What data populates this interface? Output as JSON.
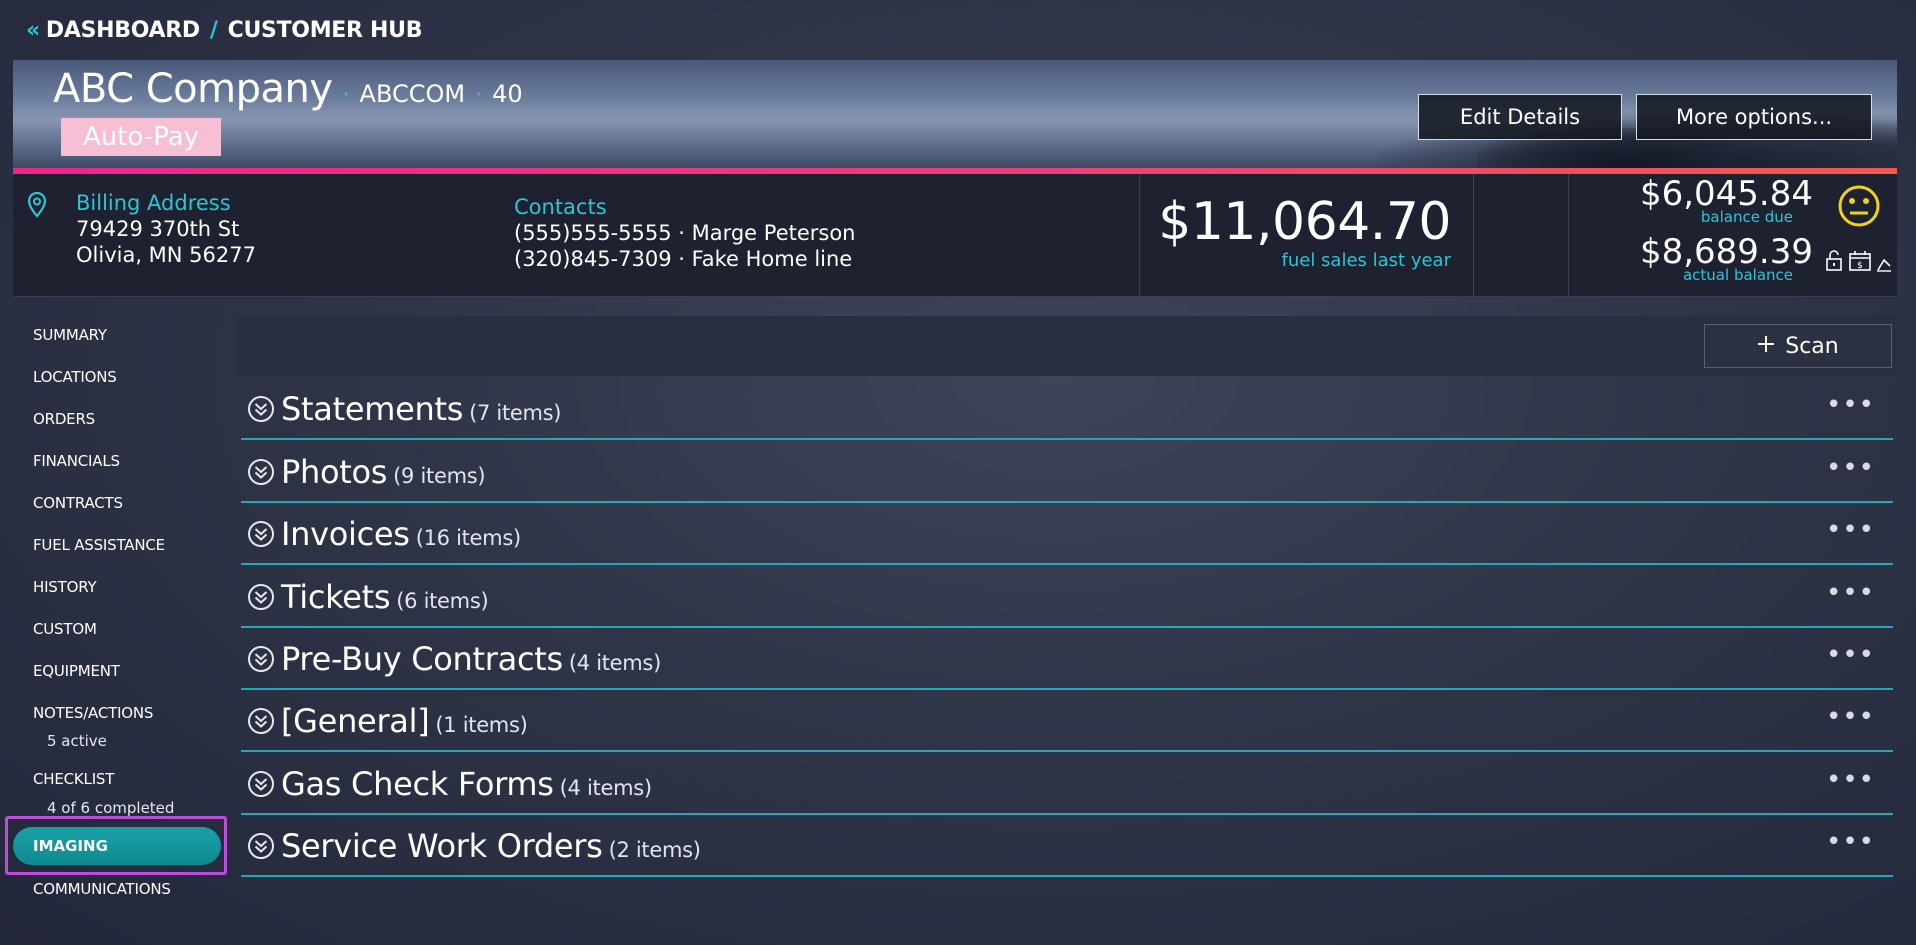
{
  "breadcrumb": {
    "items": [
      "DASHBOARD",
      "CUSTOMER HUB"
    ]
  },
  "customer": {
    "name": "ABC Company",
    "code": "ABCCOM",
    "number": "40",
    "badge": "Auto-Pay"
  },
  "header_actions": {
    "edit_label": "Edit Details",
    "more_label": "More options..."
  },
  "billing": {
    "title": "Billing Address",
    "line1": "79429 370th St",
    "line2": "Olivia, MN 56277"
  },
  "contacts": {
    "title": "Contacts",
    "items": [
      "(555)555-5555 · Marge Peterson",
      "(320)845-7309 · Fake Home line"
    ]
  },
  "fuel_sales": {
    "amount": "$11,064.70",
    "label": "fuel sales last year"
  },
  "balance": {
    "due_amount": "$6,045.84",
    "due_label": "balance due",
    "actual_amount": "$8,689.39",
    "actual_label": "actual balance",
    "status_icon": "neutral-face-icon"
  },
  "sidebar": {
    "items": [
      {
        "label": "SUMMARY"
      },
      {
        "label": "LOCATIONS"
      },
      {
        "label": "ORDERS"
      },
      {
        "label": "FINANCIALS"
      },
      {
        "label": "CONTRACTS"
      },
      {
        "label": "FUEL ASSISTANCE"
      },
      {
        "label": "HISTORY"
      },
      {
        "label": "CUSTOM"
      },
      {
        "label": "EQUIPMENT"
      },
      {
        "label": "NOTES/ACTIONS",
        "sub": "5 active"
      },
      {
        "label": "CHECKLIST",
        "sub": "4 of 6 completed"
      },
      {
        "label": "IMAGING",
        "active": true
      },
      {
        "label": "COMMUNICATIONS"
      }
    ]
  },
  "toolbar": {
    "scan_label": "Scan"
  },
  "folders": [
    {
      "name": "Statements",
      "count": "(7 items)"
    },
    {
      "name": "Photos",
      "count": "(9 items)"
    },
    {
      "name": "Invoices",
      "count": "(16 items)"
    },
    {
      "name": "Tickets",
      "count": "(6 items)"
    },
    {
      "name": "Pre-Buy Contracts",
      "count": "(4 items)"
    },
    {
      "name": "[General]",
      "count": "(1 items)"
    },
    {
      "name": "Gas Check Forms",
      "count": "(4 items)"
    },
    {
      "name": "Service Work Orders",
      "count": "(2 items)"
    }
  ],
  "colors": {
    "accent": "#2ec4d6",
    "active_nav": "#14999e",
    "badge": "#f6bfd3",
    "stripe_start": "#e8278f",
    "stripe_end": "#ee5a4f"
  }
}
